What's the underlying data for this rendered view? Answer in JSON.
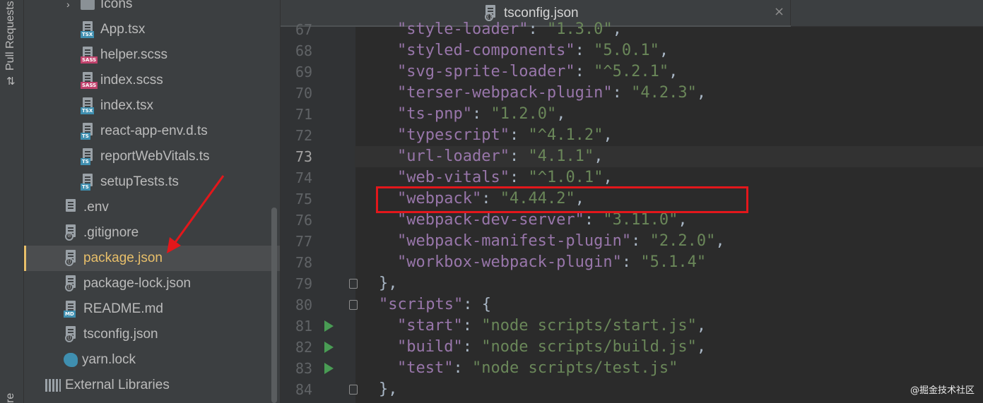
{
  "tool_strip": {
    "pull_requests_label": "Pull Requests",
    "bottom_label": "re"
  },
  "project_tree": {
    "items": [
      {
        "label": "Icons",
        "kind": "folder",
        "icon": "folder-icon"
      },
      {
        "label": "App.tsx",
        "kind": "file",
        "tag": "TSX",
        "icon": "tsx-file-icon"
      },
      {
        "label": "helper.scss",
        "kind": "file",
        "tag": "SASS",
        "icon": "sass-file-icon"
      },
      {
        "label": "index.scss",
        "kind": "file",
        "tag": "SASS",
        "icon": "sass-file-icon"
      },
      {
        "label": "index.tsx",
        "kind": "file",
        "tag": "TSX",
        "icon": "tsx-file-icon"
      },
      {
        "label": "react-app-env.d.ts",
        "kind": "file",
        "tag": "TS",
        "icon": "ts-file-icon"
      },
      {
        "label": "reportWebVitals.ts",
        "kind": "file",
        "tag": "TS",
        "icon": "ts-file-icon"
      },
      {
        "label": "setupTests.ts",
        "kind": "file",
        "tag": "TS",
        "icon": "ts-file-icon"
      },
      {
        "label": ".env",
        "kind": "file",
        "icon": "text-file-icon"
      },
      {
        "label": ".gitignore",
        "kind": "file",
        "icon": "ignore-file-icon"
      },
      {
        "label": "package.json",
        "kind": "file",
        "icon": "json-file-icon",
        "selected": true
      },
      {
        "label": "package-lock.json",
        "kind": "file",
        "icon": "json-file-icon"
      },
      {
        "label": "README.md",
        "kind": "file",
        "tag": "MD",
        "icon": "markdown-file-icon"
      },
      {
        "label": "tsconfig.json",
        "kind": "file",
        "icon": "json-file-icon"
      },
      {
        "label": "yarn.lock",
        "kind": "file",
        "icon": "yarn-icon"
      },
      {
        "label": "External Libraries",
        "kind": "libraries",
        "icon": "libraries-icon"
      }
    ]
  },
  "editor": {
    "tab": {
      "title": "tsconfig.json",
      "close_glyph": "×"
    },
    "current_line": "73",
    "lines": [
      {
        "n": "67",
        "key": "style-loader",
        "value": "1.3.0"
      },
      {
        "n": "68",
        "key": "styled-components",
        "value": "5.0.1"
      },
      {
        "n": "69",
        "key": "svg-sprite-loader",
        "value": "^5.2.1"
      },
      {
        "n": "70",
        "key": "terser-webpack-plugin",
        "value": "4.2.3"
      },
      {
        "n": "71",
        "key": "ts-pnp",
        "value": "1.2.0"
      },
      {
        "n": "72",
        "key": "typescript",
        "value": "^4.1.2"
      },
      {
        "n": "73",
        "key": "url-loader",
        "value": "4.1.1"
      },
      {
        "n": "74",
        "key": "web-vitals",
        "value": "^1.0.1"
      },
      {
        "n": "75",
        "key": "webpack",
        "value": "4.44.2"
      },
      {
        "n": "76",
        "key": "webpack-dev-server",
        "value": "3.11.0"
      },
      {
        "n": "77",
        "key": "webpack-manifest-plugin",
        "value": "2.2.0"
      },
      {
        "n": "78",
        "key": "workbox-webpack-plugin",
        "value": "5.1.4"
      },
      {
        "n": "79",
        "raw": "},"
      },
      {
        "n": "80",
        "key": "scripts",
        "open": "{"
      },
      {
        "n": "81",
        "key": "start",
        "value": "node scripts/start.js",
        "runnable": true
      },
      {
        "n": "82",
        "key": "build",
        "value": "node scripts/build.js",
        "runnable": true
      },
      {
        "n": "83",
        "key": "test",
        "value": "node scripts/test.js",
        "runnable": true
      },
      {
        "n": "84",
        "raw": "},"
      }
    ]
  },
  "watermark": "@掘金技术社区",
  "colors": {
    "json_key": "#9876aa",
    "json_string": "#6a8759",
    "punctuation": "#a9b7c6",
    "highlight_box": "#e3171b",
    "arrow": "#e3171b",
    "selection_text": "#e8bf6a",
    "run_icon": "#499c54"
  }
}
